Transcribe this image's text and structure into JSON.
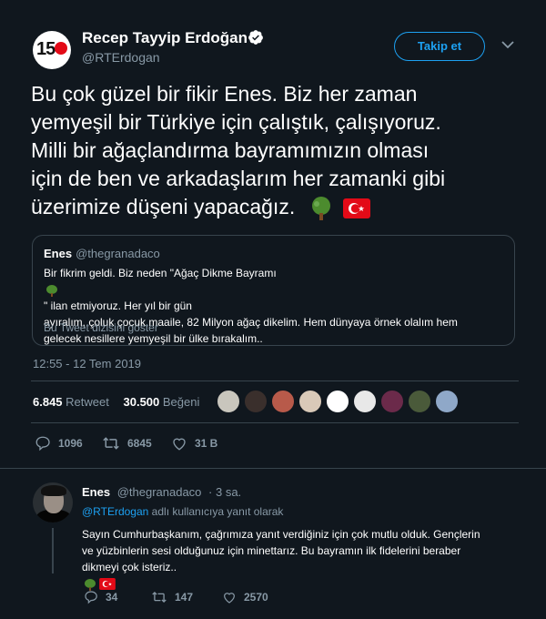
{
  "header": {
    "name": "Recep Tayyip Erdoğan",
    "handle": "@RTErdogan",
    "follow_label": "Takip et",
    "avatar_text": "15"
  },
  "tweet": {
    "lines": [
      "Bu çok güzel bir fikir Enes. Biz her zaman",
      "yemyeşil bir Türkiye için çalıştık, çalışıyoruz.",
      "Milli bir ağaçlandırma bayramımızın olması",
      "için de ben ve arkadaşlarım her zamanki gibi",
      "üzerimize düşeni yapacağız."
    ],
    "emojis": [
      "tree-emoji",
      "turkey-flag-emoji"
    ]
  },
  "quote": {
    "name": "Enes",
    "handle": "@thegranadaco",
    "lines": [
      "Bir fikrim geldi. Biz neden \"Ağaç Dikme Bayramı",
      "\" ilan etmiyoruz. Her yıl bir gün",
      "ayıralım, çoluk çocuk maaile, 82 Milyon ağaç dikelim. Hem dünyaya örnek olalım hem",
      "gelecek nesillere yemyeşil bir ülke bırakalım.."
    ],
    "thread_label": "Bu Tweet dizisini göster"
  },
  "timestamp": "12:55 - 12 Tem 2019",
  "stats": {
    "retweets_value": "6.845",
    "retweets_label": "Retweet",
    "likes_value": "30.500",
    "likes_label": "Beğeni"
  },
  "actions": {
    "replies": "1096",
    "retweets": "6845",
    "likes": "31 B"
  },
  "reply": {
    "name": "Enes",
    "handle": "@thegranadaco",
    "time": "· 3 sa.",
    "replying_mention": "@RTErdogan",
    "replying_suffix": " adlı kullanıcıya yanıt olarak",
    "lines": [
      "Sayın Cumhurbaşkanım, çağrımıza yanıt verdiğiniz için çok mutlu olduk. Gençlerin",
      "ve yüzbinlerin sesi olduğunuz için minettarız. Bu bayramın ilk fidelerini beraber",
      "dikmeyi çok isteriz.."
    ],
    "actions": {
      "replies": "34",
      "retweets": "147",
      "likes": "2570"
    }
  },
  "colors": {
    "background": "#10171e",
    "accent": "#1da1f2",
    "muted": "#8899a6",
    "border": "#38444d",
    "flag_red": "#e30a17",
    "tree_green": "#4c8b2e"
  },
  "icons": [
    "verified-badge-icon",
    "chevron-down-icon",
    "reply-icon",
    "retweet-icon",
    "like-icon"
  ]
}
